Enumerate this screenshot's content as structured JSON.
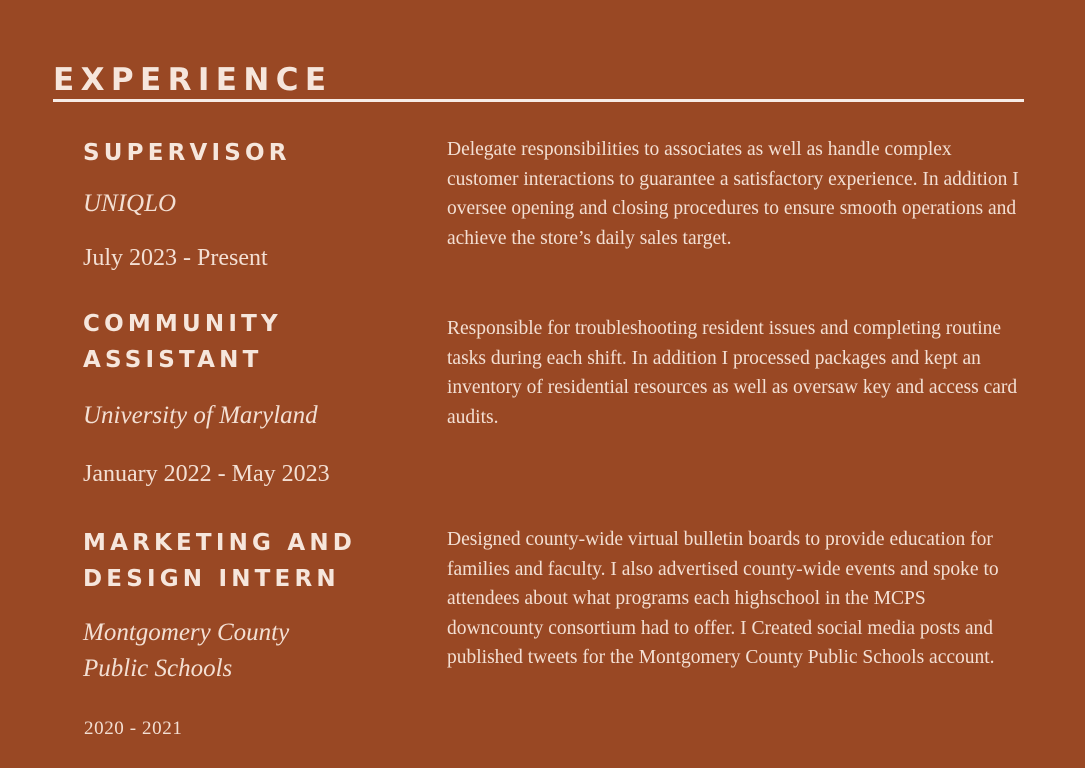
{
  "section": {
    "heading": "EXPERIENCE"
  },
  "jobs": [
    {
      "title_lines": [
        "SUPERVISOR"
      ],
      "org_lines": [
        "UNIQLO"
      ],
      "dates": "July 2023 - Present",
      "description": "Delegate responsibilities to associates as well as handle complex customer interactions to guarantee a satisfactory experience. In addition I oversee opening and closing procedures to ensure smooth operations and achieve the store’s daily sales target."
    },
    {
      "title_lines": [
        "COMMUNITY",
        "ASSISTANT"
      ],
      "org_lines": [
        "University of Maryland"
      ],
      "dates": "January 2022 - May 2023",
      "description": "Responsible for troubleshooting resident issues and completing routine tasks during each shift. In addition I processed packages and kept an inventory of residential resources as well as oversaw key and access card audits."
    },
    {
      "title_lines": [
        "MARKETING AND",
        "DESIGN INTERN"
      ],
      "org_lines": [
        "Montgomery County",
        "Public Schools"
      ],
      "dates": "2020 - 2021",
      "description": "Designed county-wide virtual bulletin boards to provide education for families and faculty. I also advertised county-wide events and spoke to attendees about what programs each highschool in the MCPS downcounty consortium had to offer. I Created social media posts and published tweets for the Montgomery County Public Schools account."
    }
  ]
}
